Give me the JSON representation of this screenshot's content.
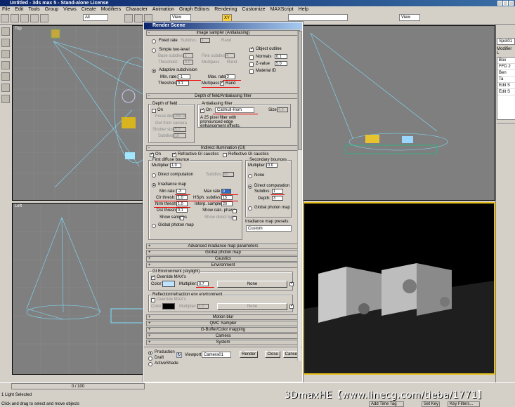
{
  "window": {
    "title": "Untitled - 3ds max 5 - Stand-alone License"
  },
  "menu": [
    "File",
    "Edit",
    "Tools",
    "Group",
    "Views",
    "Create",
    "Modifiers",
    "Character",
    "Animation",
    "Graph Editors",
    "Rendering",
    "Customize",
    "MAXScript",
    "Help"
  ],
  "toolbar": {
    "filter": "All",
    "refcoord": "View",
    "axis": "XY",
    "view2": "View"
  },
  "viewports": {
    "top": "Top",
    "left": "Left"
  },
  "right_panel": {
    "name": "Spot01",
    "modlist": "Modifier L",
    "items": [
      "Box",
      "FFD 2",
      "Ben",
      "Ta",
      "Edit S",
      "Edit S"
    ]
  },
  "dialog": {
    "title": "Render Scene",
    "image_sampler": {
      "header": "Image sampler (Antialiasing)",
      "fixed_rate": "Fixed rate",
      "subdivs": "Subdivs:",
      "subdivs_val": "1",
      "rand": "Rand",
      "simple": "Simple two-level",
      "base_subdivs": "Base subdivs:",
      "base_val": "1",
      "fine_subdivs": "Fine subdivs:",
      "fine_val": "4",
      "threshold": "Threshold:",
      "threshold_val": "0.0",
      "multipass": "Multipass",
      "rand2": "Rand",
      "adaptive": "Adaptive subdivision",
      "min_rate": "Min. rate:",
      "min_rate_val": "-1",
      "max_rate": "Max. rate:",
      "max_rate_val": "2",
      "threshold2": "Threshold:",
      "threshold2_val": "0.1",
      "multipass2": "Multipass",
      "rand3": "Rand",
      "object_outline": "Object outline",
      "normals": "Normals",
      "normals_val": "0.1",
      "zvalue": "Z-value",
      "zvalue_val": "5.0",
      "material_id": "Material ID"
    },
    "dof": {
      "header": "Depth of field/Antialiasing filter",
      "dof_title": "Depth of field",
      "on": "On",
      "focal_dist": "Focal dist",
      "focal_val": "200.0",
      "get_from_camera": "Get from camera",
      "shutter_size": "Shutter size",
      "shutter_val": "5.0",
      "subdivs": "Subdivs",
      "subdivs_val": "10",
      "aa_title": "Antialiasing filter",
      "aa_on": "On",
      "filter": "Catmull-Rom",
      "size": "Size:",
      "size_val": "4.0",
      "desc": "A 25 pixel filter with pronounced edge enhancement effects."
    },
    "gi": {
      "header": "Indirect illumination (GI)",
      "on": "On",
      "refractive": "Refractive GI caustics",
      "reflective": "Reflective GI caustics",
      "first_bounce": "First diffuse bounce",
      "multiplier": "Multiplier:",
      "mult_val": "1.0",
      "direct": "Direct computation",
      "subdivs": "Subdivs:",
      "subdivs_val": "50",
      "irradiance": "Irradiance map",
      "min_rate": "Min rate:",
      "min_rate_val": "-3",
      "max_rate": "Max rate:",
      "max_rate_val": "0",
      "clr_thresh": "Clr thresh:",
      "clr_val": "1.0",
      "hsph": "HSph. subdivs:",
      "hsph_val": "15",
      "nrm_thresh": "Nrm thresh:",
      "nrm_val": "1.0",
      "interp": "Interp. samples:",
      "interp_val": "20",
      "dst_thresh": "Dst thresh:",
      "dst_val": "0.1",
      "show_calc": "Show calc. phase",
      "show_samples": "Show samples",
      "show_direct": "Show direct light",
      "global_photon": "Global photon map",
      "secondary": "Secondary bounces",
      "sec_mult": "Multiplier:",
      "sec_mult_val": "0.6",
      "none": "None",
      "direct2": "Direct computation",
      "subdivs2": "Subdivs:",
      "subdivs2_val": "1",
      "depth": "Depth:",
      "depth_val": "3",
      "global_photon2": "Global photon map",
      "presets": "Irradiance map presets:",
      "preset_val": "Custom"
    },
    "rollouts": [
      "Advanced irradiance map parameters",
      "Global photon map",
      "Caustics",
      "Environment"
    ],
    "env": {
      "gi_env": "GI Environment (skylight)",
      "override": "Override MAX's",
      "color": "Color:",
      "multiplier": "Multiplier:",
      "mult_val": "0.7",
      "none": "None",
      "refl_env": "Reflection/refraction env environment",
      "override2": "Override MAX's",
      "color2": "Color:",
      "multiplier2": "Multiplier:",
      "mult2_val": "1.0",
      "none2": "None"
    },
    "rollouts2": [
      "Motion blur",
      "QMC Sampler",
      "G-Buffer/Color mapping",
      "Camera",
      "System"
    ],
    "bottom": {
      "production": "Production",
      "draft": "Draft",
      "activeshade": "ActiveShade",
      "viewport": "Viewport:",
      "viewport_val": "Camera01",
      "render": "Render",
      "close": "Close",
      "cancel": "Cancel"
    }
  },
  "status": {
    "frames": "0 / 100",
    "selected": "1 Light Selected",
    "hint": "Click and drag to select and move objects",
    "coord": "-249.",
    "add_time_tag": "Add Time Tag",
    "set_key": "Set Key",
    "key_filters": "Key Filters..."
  },
  "watermark": "3DmaxHE【www.linecg.com/tieba/1771】"
}
